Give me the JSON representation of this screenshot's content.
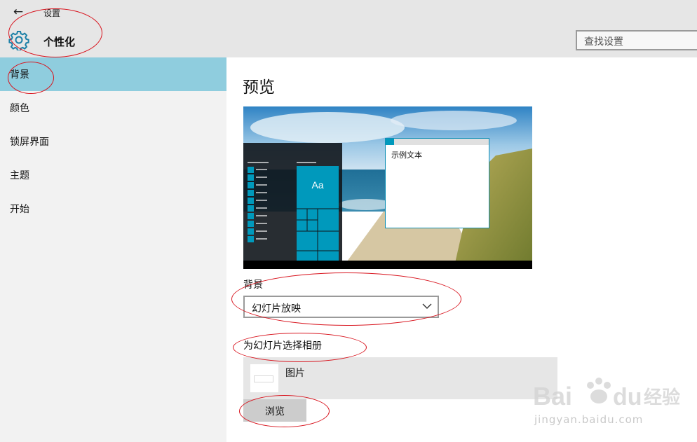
{
  "window": {
    "app_title": "设置",
    "section_title": "个性化",
    "back_icon": "back-arrow-icon",
    "settings_icon": "gear-icon"
  },
  "search": {
    "placeholder": "查找设置"
  },
  "sidebar": {
    "items": [
      {
        "label": "背景",
        "active": true
      },
      {
        "label": "颜色",
        "active": false
      },
      {
        "label": "锁屏界面",
        "active": false
      },
      {
        "label": "主题",
        "active": false
      },
      {
        "label": "开始",
        "active": false
      }
    ]
  },
  "main": {
    "preview_title": "预览",
    "preview": {
      "sample_text": "示例文本",
      "tile_label": "Aa"
    },
    "background": {
      "label": "背景",
      "selected": "幻灯片放映"
    },
    "album": {
      "label": "为幻灯片选择相册",
      "folder_name": "图片",
      "browse_label": "浏览"
    }
  },
  "watermark": {
    "url": "jingyan.baidu.com"
  },
  "colors": {
    "accent": "#0099bc",
    "active_nav": "#8fcdde",
    "sidebar_bg": "#f2f2f2",
    "topbar_bg": "#e6e6e6",
    "annotation": "#d8141e"
  }
}
